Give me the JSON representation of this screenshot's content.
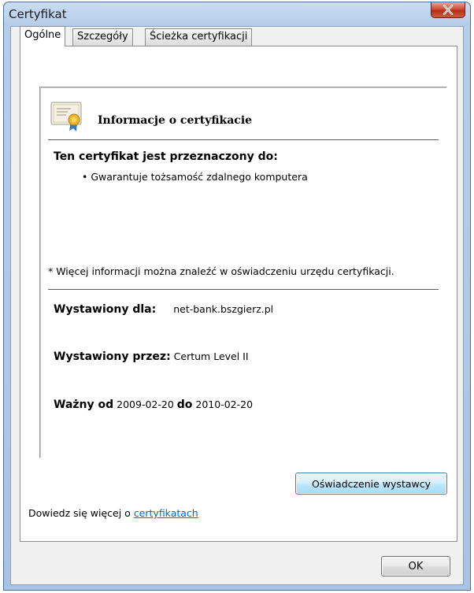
{
  "window": {
    "title": "Certyfikat"
  },
  "tabs": [
    {
      "label": "Ogólne",
      "active": true
    },
    {
      "label": "Szczegóły",
      "active": false
    },
    {
      "label": "Ścieżka certyfikacji",
      "active": false
    }
  ],
  "info": {
    "title": "Informacje o certyfikacie",
    "purpose_heading": "Ten certyfikat jest przeznaczony do:",
    "purpose_items": [
      "Gwarantuje tożsamość zdalnego komputera"
    ],
    "more_info": "* Więcej informacji można znaleźć w oświadczeniu urzędu certyfikacji.",
    "issued_to_label": "Wystawiony dla:",
    "issued_to_value": "net-bank.bszgierz.pl",
    "issued_by_label": "Wystawiony przez:",
    "issued_by_value": "Certum Level II",
    "valid_from_label": "Ważny od",
    "valid_from_value": "2009-02-20",
    "valid_to_label": "do",
    "valid_to_value": "2010-02-20"
  },
  "buttons": {
    "issuer_statement": "Oświadczenie wystawcy",
    "ok": "OK"
  },
  "learn_more": {
    "prefix": "Dowiedz się więcej o",
    "link": "certyfikatach"
  },
  "icons": {
    "close": "close-icon",
    "certificate": "certificate-icon"
  },
  "colors": {
    "close_button": "#c9472f",
    "link": "#0066cc",
    "title_bar": "#b5cde9"
  }
}
